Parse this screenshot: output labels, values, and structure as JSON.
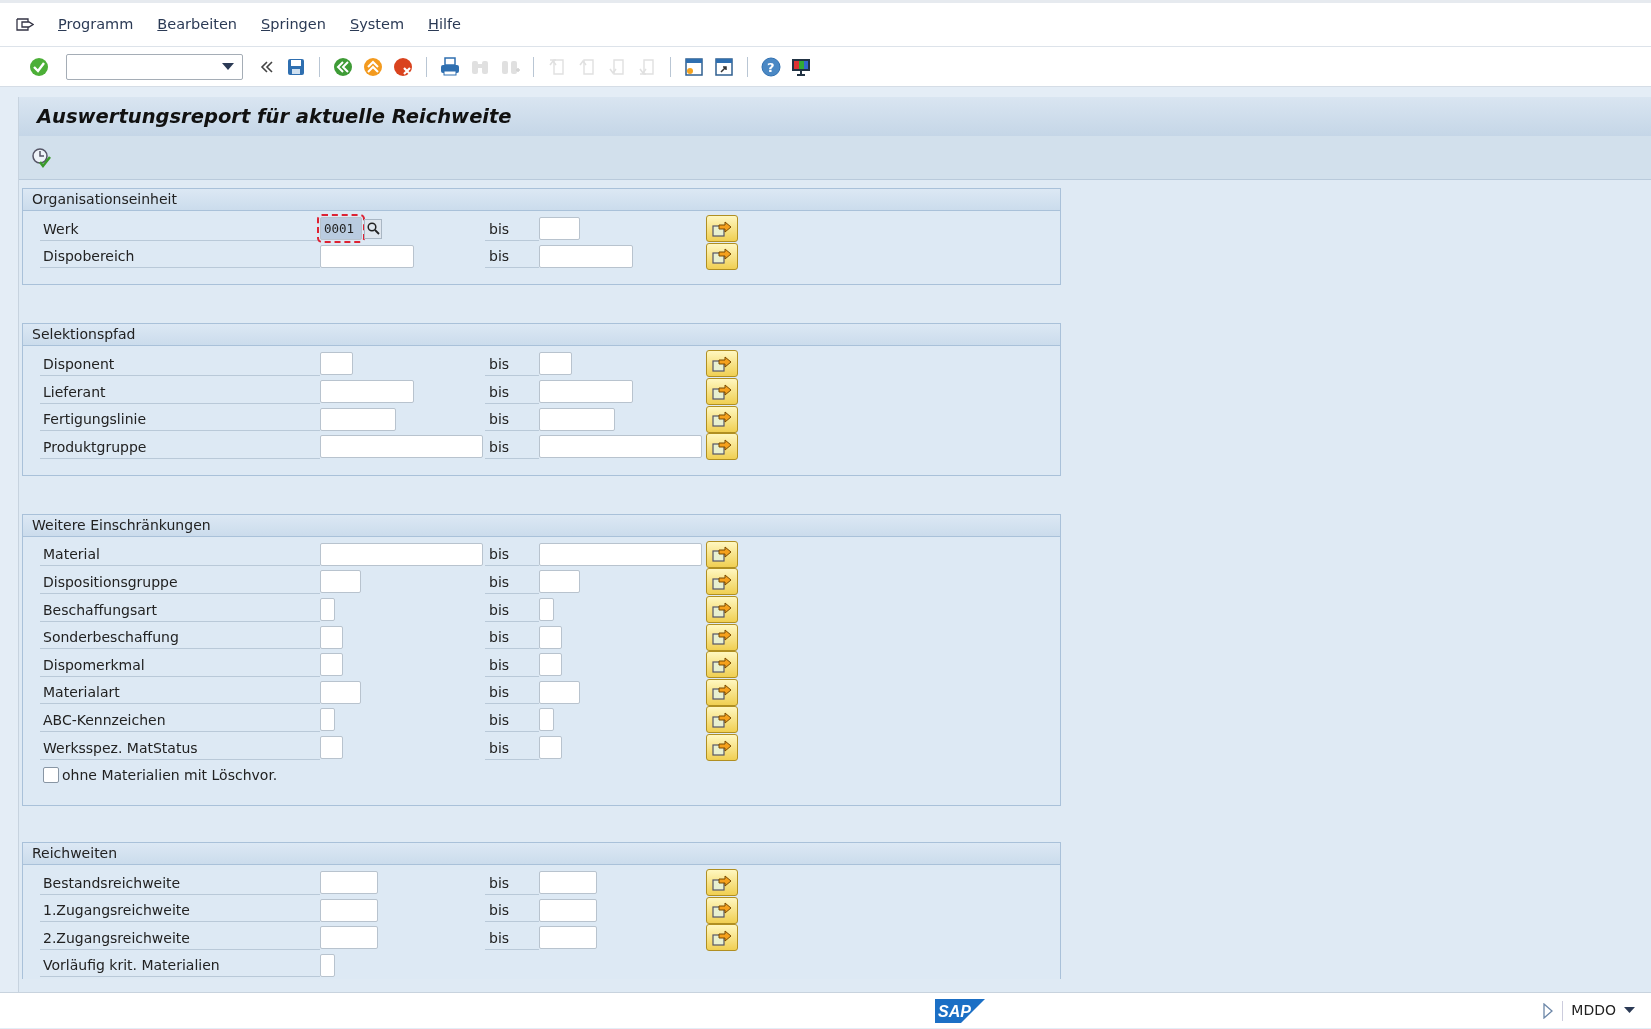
{
  "menu": [
    {
      "label": "Programm"
    },
    {
      "label": "Bearbeiten"
    },
    {
      "label": "Springen"
    },
    {
      "label": "System"
    },
    {
      "label": "Hilfe"
    }
  ],
  "toolbar": [
    {
      "kind": "enter",
      "disabled": false
    },
    {
      "kind": "command"
    },
    {
      "kind": "collapse",
      "disabled": false
    },
    {
      "kind": "save",
      "disabled": false
    },
    {
      "kind": "sep"
    },
    {
      "kind": "back",
      "disabled": false
    },
    {
      "kind": "exit",
      "disabled": false
    },
    {
      "kind": "cancel",
      "disabled": false
    },
    {
      "kind": "sep"
    },
    {
      "kind": "print",
      "disabled": false
    },
    {
      "kind": "find",
      "disabled": true
    },
    {
      "kind": "findnext",
      "disabled": true
    },
    {
      "kind": "sep"
    },
    {
      "kind": "first",
      "disabled": true
    },
    {
      "kind": "prev",
      "disabled": true
    },
    {
      "kind": "next",
      "disabled": true
    },
    {
      "kind": "last",
      "disabled": true
    },
    {
      "kind": "sep"
    },
    {
      "kind": "session",
      "disabled": false
    },
    {
      "kind": "shortcut",
      "disabled": false
    },
    {
      "kind": "sep"
    },
    {
      "kind": "help",
      "label": "?",
      "disabled": false
    },
    {
      "kind": "layout",
      "disabled": false
    }
  ],
  "title": "Auswertungsreport für aktuelle Reichweite",
  "groups": [
    {
      "title": "Organisationseinheit",
      "rows": [
        {
          "kind": "range",
          "label": "Werk",
          "low": "0001",
          "bis": "bis",
          "focused": true
        },
        {
          "kind": "range",
          "label": "Dispobereich",
          "bis": "bis",
          "focused": false
        }
      ]
    },
    {
      "title": "Selektionspfad",
      "rows": [
        {
          "kind": "range",
          "label": "Disponent",
          "bis": "bis",
          "focused": false
        },
        {
          "kind": "range",
          "label": "Lieferant",
          "bis": "bis",
          "focused": false
        },
        {
          "kind": "range",
          "label": "Fertigungslinie",
          "bis": "bis",
          "focused": false
        },
        {
          "kind": "range",
          "label": "Produktgruppe",
          "bis": "bis",
          "focused": false
        }
      ]
    },
    {
      "title": "Weitere Einschränkungen",
      "rows": [
        {
          "kind": "range",
          "label": "Material",
          "bis": "bis",
          "focused": false
        },
        {
          "kind": "range",
          "label": "Dispositionsgruppe",
          "bis": "bis",
          "focused": false
        },
        {
          "kind": "range",
          "label": "Beschaffungsart",
          "bis": "bis",
          "focused": false
        },
        {
          "kind": "range",
          "label": "Sonderbeschaffung",
          "bis": "bis",
          "focused": false
        },
        {
          "kind": "range",
          "label": "Dispomerkmal",
          "bis": "bis",
          "focused": false
        },
        {
          "kind": "range",
          "label": "Materialart",
          "bis": "bis",
          "focused": false
        },
        {
          "kind": "range",
          "label": "ABC-Kennzeichen",
          "bis": "bis",
          "focused": false
        },
        {
          "kind": "range",
          "label": "Werksspez. MatStatus",
          "bis": "bis",
          "focused": false
        },
        {
          "kind": "checkbox",
          "label": "ohne Materialien mit Löschvor.",
          "checked": false
        }
      ]
    },
    {
      "title": "Reichweiten",
      "rows": [
        {
          "kind": "range",
          "label": "Bestandsreichweite",
          "bis": "bis",
          "focused": false
        },
        {
          "kind": "range",
          "label": "1.Zugangsreichweite",
          "bis": "bis",
          "focused": false
        },
        {
          "kind": "range",
          "label": "2.Zugangsreichweite",
          "bis": "bis",
          "focused": false
        },
        {
          "kind": "single",
          "label": "Vorläufig krit. Materialien"
        }
      ]
    }
  ],
  "status_bar": {
    "logo": "SAP",
    "system": "MDDO"
  }
}
